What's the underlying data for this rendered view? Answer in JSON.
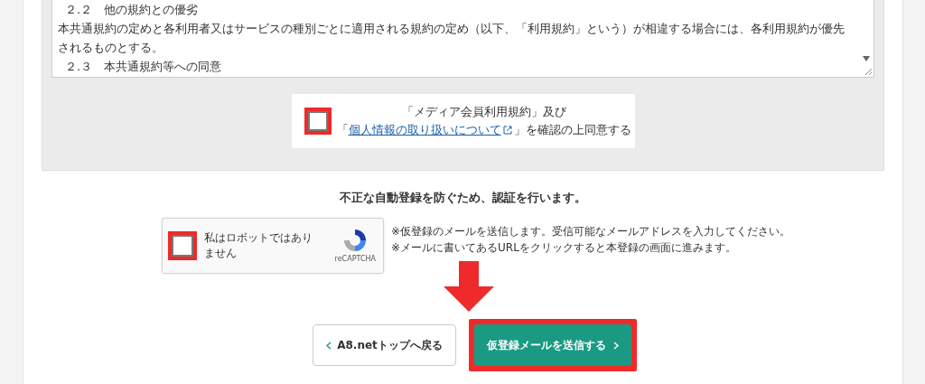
{
  "terms_box": {
    "lines": [
      {
        "kind": "heading",
        "text": "２.２　他の規約との優劣"
      },
      {
        "kind": "body",
        "text": "本共通規約の定めと各利用者又はサービスの種別ごとに適用される規約の定め（以下、「利用規約」という）が相違する場合には、各利用規約が優先されるものとする。"
      },
      {
        "kind": "heading",
        "text": "２.３　本共通規約等への同意"
      }
    ]
  },
  "agreement": {
    "checked": false,
    "highlighted": true,
    "line_1": "「メディア会員利用規約」及び",
    "prefix": "「",
    "link": "個人情報の取り扱いについて",
    "suffix": "」を確認の上同意する"
  },
  "captcha_heading": "不正な自動登録を防ぐため、認証を行います。",
  "captcha": {
    "checked": false,
    "highlighted": true,
    "label": "私はロボットではありません",
    "brand": "reCAPTCHA"
  },
  "notes": [
    "※仮登録のメールを送信します。受信可能なメールアドレスを入力してください。",
    "※メールに書いてあるURLをクリックすると本登録の画面に進みます。"
  ],
  "buttons": [
    {
      "kind": "back",
      "label": "A8.netトップへ戻る",
      "highlighted": false
    },
    {
      "kind": "submit",
      "label": "仮登録メールを送信する",
      "highlighted": true
    }
  ]
}
